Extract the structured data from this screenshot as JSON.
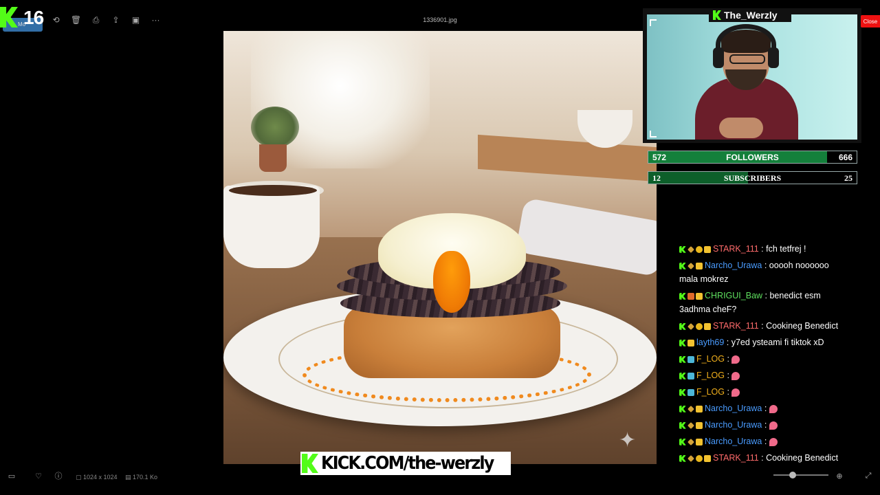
{
  "viewer": {
    "filename": "1336901.jpg",
    "image_dimensions": "1024 x 1024",
    "file_size": "170.1 Ko",
    "zoom_level": 0.35
  },
  "kick_badge": {
    "count": "16",
    "pill_label": "Mo"
  },
  "streamer": {
    "name": "The_Werzly",
    "close_label": "Close"
  },
  "goals": [
    {
      "label": "FOLLOWERS",
      "current": "572",
      "target": "666",
      "fraction": 0.859,
      "color": "#14803b"
    },
    {
      "label": "SUBSCRIBERS",
      "current": "12",
      "target": "25",
      "fraction": 0.48,
      "color": "#0d5f2a"
    }
  ],
  "chat": {
    "messages": [
      {
        "badges": [
          "kick",
          "sword",
          "coin",
          "crown"
        ],
        "user": "STARK_111",
        "user_color": "#ff6b6b",
        "text": "fch tetfrej !"
      },
      {
        "badges": [
          "kick",
          "sword",
          "crown"
        ],
        "user": "Narcho_Urawa",
        "user_color": "#4a9cff",
        "text": "ooooh noooooo mala mokrez"
      },
      {
        "badges": [
          "kick",
          "fire",
          "crown"
        ],
        "user": "CHRIGUI_Baw",
        "user_color": "#5fe05f",
        "text": "benedict esm 3adhma cheF?"
      },
      {
        "badges": [
          "kick",
          "sword",
          "coin",
          "crown"
        ],
        "user": "STARK_111",
        "user_color": "#ff6b6b",
        "text": "Cookineg Benedict"
      },
      {
        "badges": [
          "kick",
          "crown"
        ],
        "user": "layth69",
        "user_color": "#4a9cff",
        "text": "y7ed ysteami fi tiktok xD"
      },
      {
        "badges": [
          "kick",
          "chat"
        ],
        "user": "F_LOG",
        "user_color": "#f2b01c",
        "text": "",
        "emote": true
      },
      {
        "badges": [
          "kick",
          "chat"
        ],
        "user": "F_LOG",
        "user_color": "#f2b01c",
        "text": "",
        "emote": true
      },
      {
        "badges": [
          "kick",
          "chat"
        ],
        "user": "F_LOG",
        "user_color": "#f2b01c",
        "text": "",
        "emote": true
      },
      {
        "badges": [
          "kick",
          "sword",
          "crown"
        ],
        "user": "Narcho_Urawa",
        "user_color": "#4a9cff",
        "text": "",
        "emote": true
      },
      {
        "badges": [
          "kick",
          "sword",
          "crown"
        ],
        "user": "Narcho_Urawa",
        "user_color": "#4a9cff",
        "text": "",
        "emote": true
      },
      {
        "badges": [
          "kick",
          "sword",
          "crown"
        ],
        "user": "Narcho_Urawa",
        "user_color": "#4a9cff",
        "text": "",
        "emote": true
      },
      {
        "badges": [
          "kick",
          "sword",
          "coin",
          "crown"
        ],
        "user": "STARK_111",
        "user_color": "#ff6b6b",
        "text": "Cookineg Benedict"
      }
    ]
  },
  "banner": {
    "text": "KICK.COM/the-werzly"
  },
  "icons": {
    "top_toolbar": [
      "rotate-icon",
      "delete-icon",
      "print-icon",
      "share-icon",
      "slideshow-icon",
      "more-icon"
    ],
    "bottom_toolbar": [
      "filmstrip-icon",
      "favorite-icon",
      "info-icon"
    ]
  }
}
